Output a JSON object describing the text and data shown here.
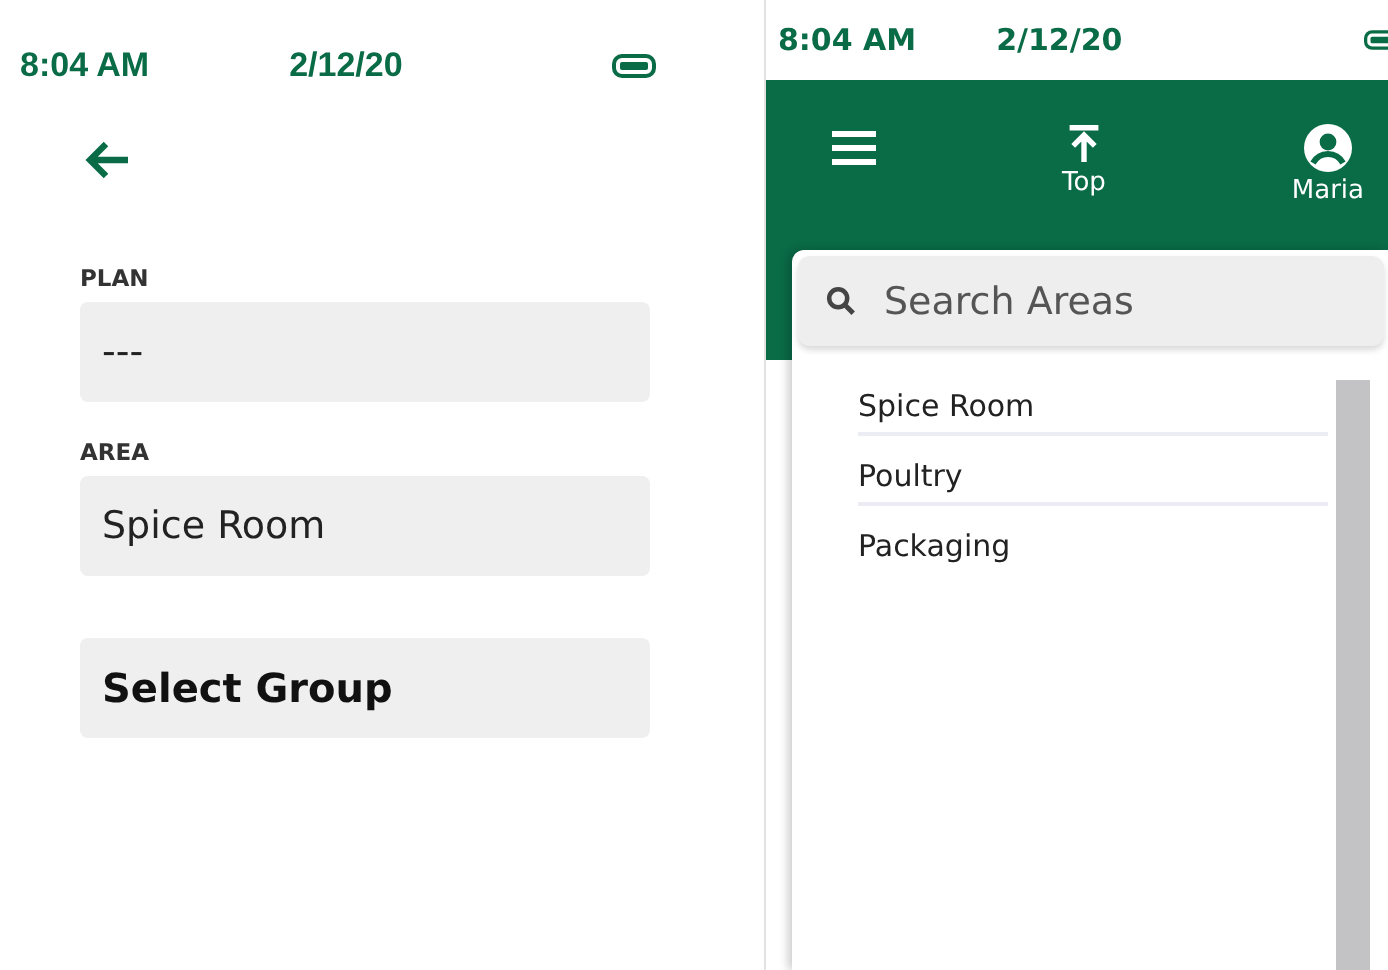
{
  "left_screen": {
    "status_bar": {
      "time": "8:04 AM",
      "date": "2/12/20"
    },
    "fields": [
      {
        "label": "PLAN",
        "value": "---"
      },
      {
        "label": "AREA",
        "value": "Spice Room"
      }
    ],
    "select_group_button": {
      "label": "Select Group"
    }
  },
  "right_screen": {
    "status_bar": {
      "time": "8:04 AM",
      "date": "2/12/20"
    },
    "header": {
      "top_label": "Top",
      "user_name": "Maria"
    },
    "search": {
      "placeholder": "Search Areas"
    },
    "areas": [
      {
        "label": "Spice Room"
      },
      {
        "label": "Poultry"
      },
      {
        "label": "Packaging"
      }
    ]
  }
}
